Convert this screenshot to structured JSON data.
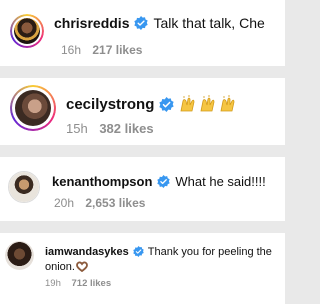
{
  "comments": [
    {
      "username": "chrisreddis",
      "text": "Talk that talk, Che",
      "time": "16h",
      "likes": "217 likes",
      "verified": true
    },
    {
      "username": "cecilystrong",
      "text": "",
      "emoji": "🙌🙌🙌",
      "emoji_icon": "raising-hands-icon",
      "time": "15h",
      "likes": "382 likes",
      "verified": true
    },
    {
      "username": "kenanthompson",
      "text": "What he said!!!!",
      "time": "20h",
      "likes": "2,653 likes",
      "verified": true
    },
    {
      "username": "iamwandasykes",
      "text": "Thank you for peeling the",
      "text_line2": "onion.",
      "emoji": "🫶🏾",
      "emoji_icon": "heart-hands-icon",
      "time": "19h",
      "likes": "712 likes",
      "verified": true
    }
  ],
  "colors": {
    "verified_badge": "#3897f0",
    "meta_text": "#8e8e8e",
    "story_ring": [
      "#f9ce34",
      "#ee2a7b",
      "#6228d7"
    ],
    "emoji_yellow": "#f5c542"
  }
}
